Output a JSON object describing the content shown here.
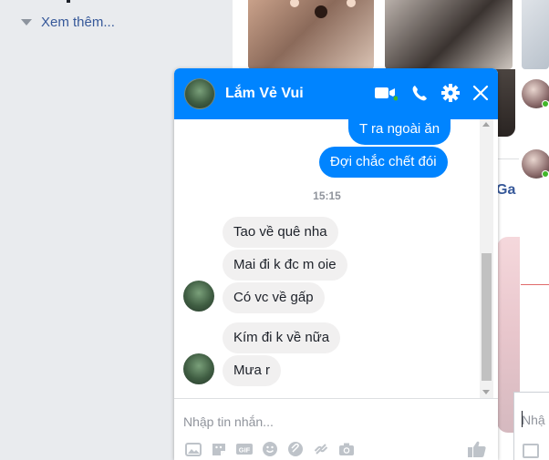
{
  "left_nav": {
    "see_more": "Xem thêm..."
  },
  "chat": {
    "contact_name": "Lắm Vẻ Vui",
    "header_icons": [
      "video-call-icon",
      "phone-icon",
      "gear-icon",
      "close-icon"
    ],
    "messages_out": [
      "T ra ngoài ăn",
      "Đợi chắc chết đói"
    ],
    "timestamp": "15:15",
    "messages_in": [
      "Tao về quê nha",
      "Mai đi k đc m oie",
      "Có vc về gấp",
      "Kím đi k về nữa",
      "Mưa r"
    ],
    "composer_placeholder": "Nhập tin nhắn...",
    "composer_tools": [
      "photo-icon",
      "sticker-icon",
      "gif-icon",
      "emoji-icon",
      "attachment-icon",
      "link-icon",
      "camera-icon",
      "thumbs-up-icon"
    ]
  },
  "feed": {
    "partial_text": "Ga"
  },
  "chat2": {
    "composer_placeholder": "Nhậ"
  },
  "colors": {
    "messenger_blue": "#0084ff",
    "incoming_bubble": "#f1f0f0",
    "online_green": "#42b72a"
  }
}
